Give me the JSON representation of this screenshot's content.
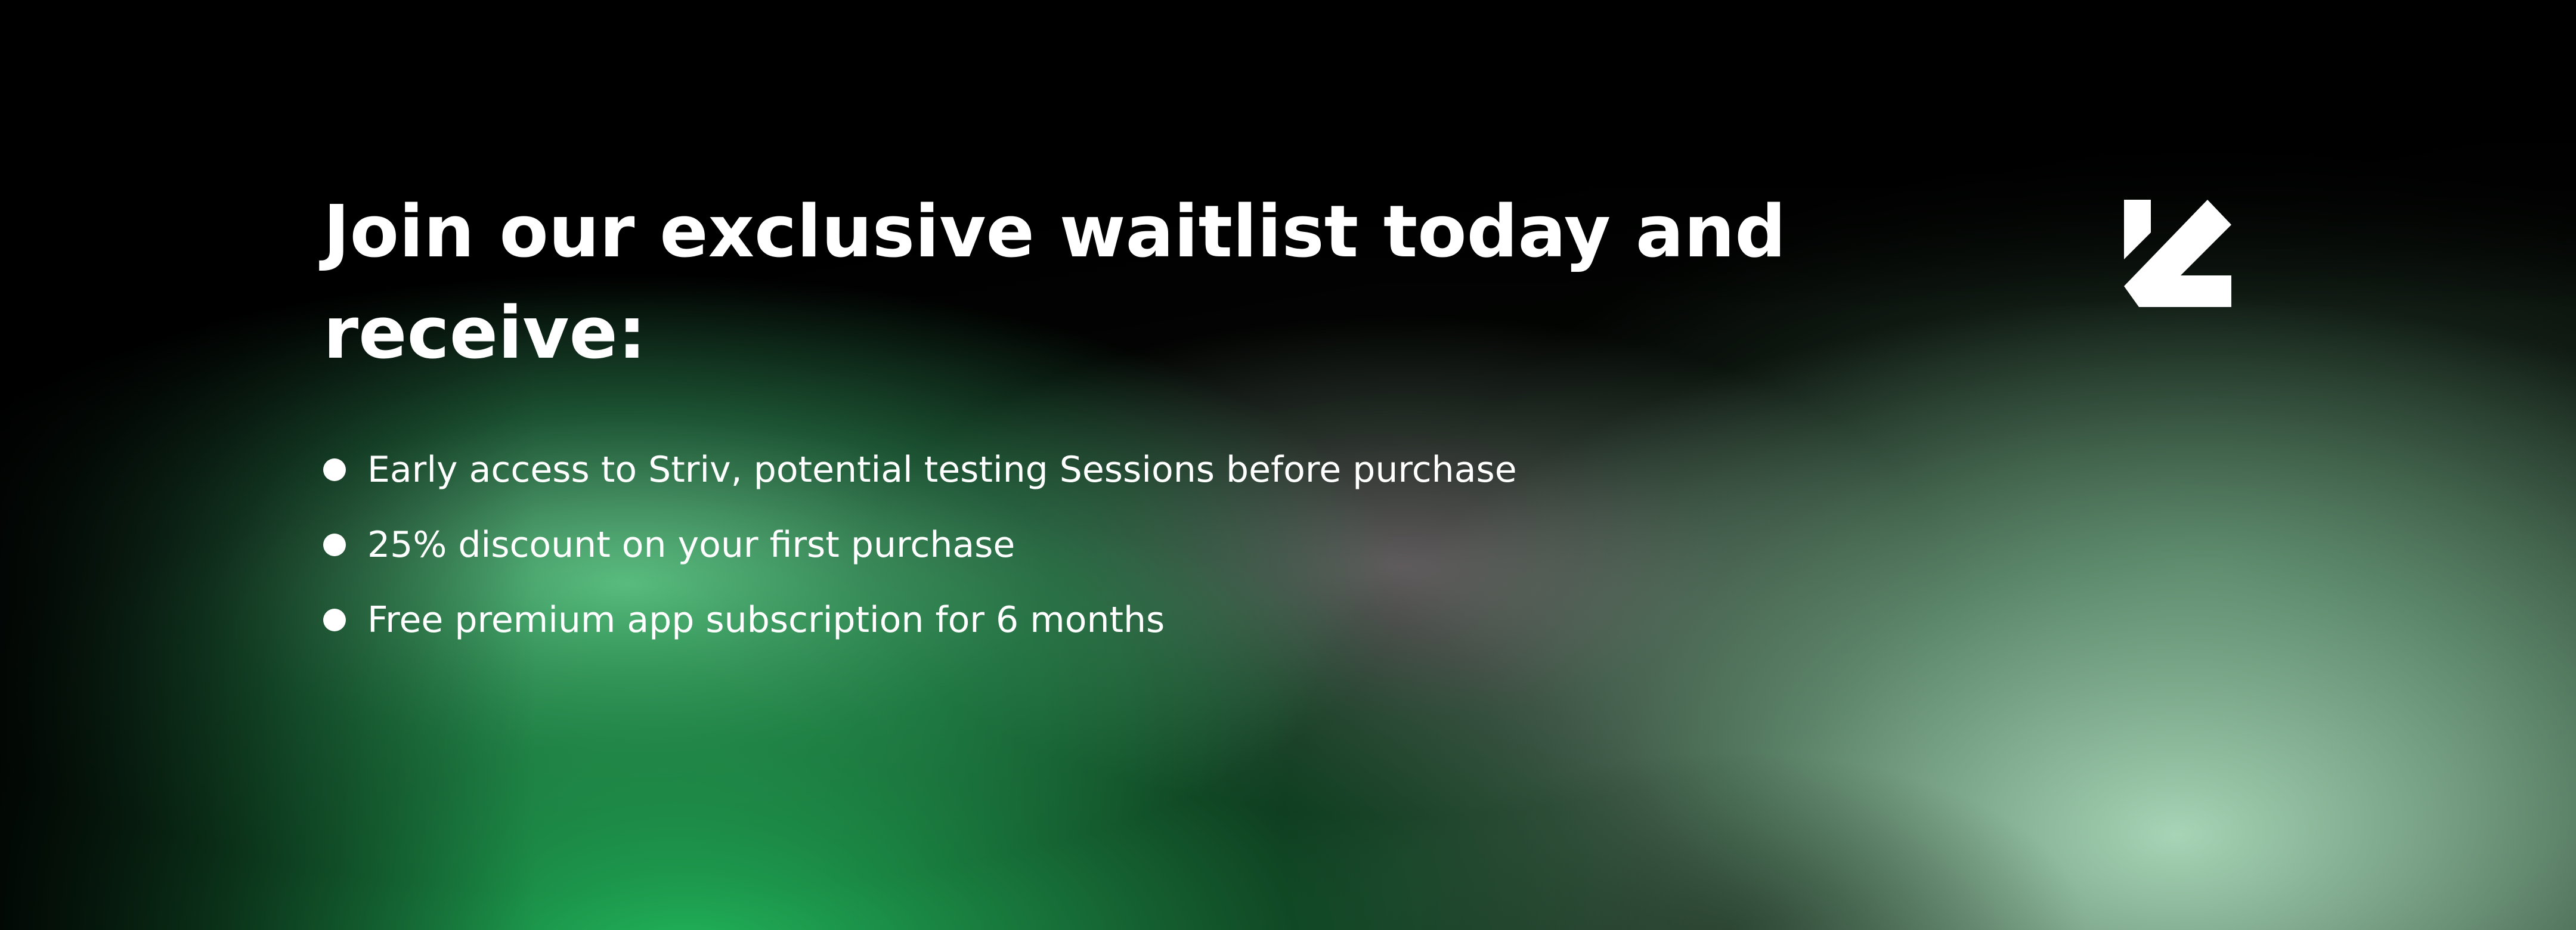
{
  "headline": "Join our exclusive waitlist today and receive:",
  "benefits": [
    "Early access to Striv, potential testing Sessions before purchase",
    "25% discount on your first purchase",
    "Free premium app subscription for 6 months"
  ],
  "logo_icon": "striv-logo-icon",
  "colors": {
    "background": "#000000",
    "accent_green": "#2dbb63",
    "text": "#ffffff"
  }
}
